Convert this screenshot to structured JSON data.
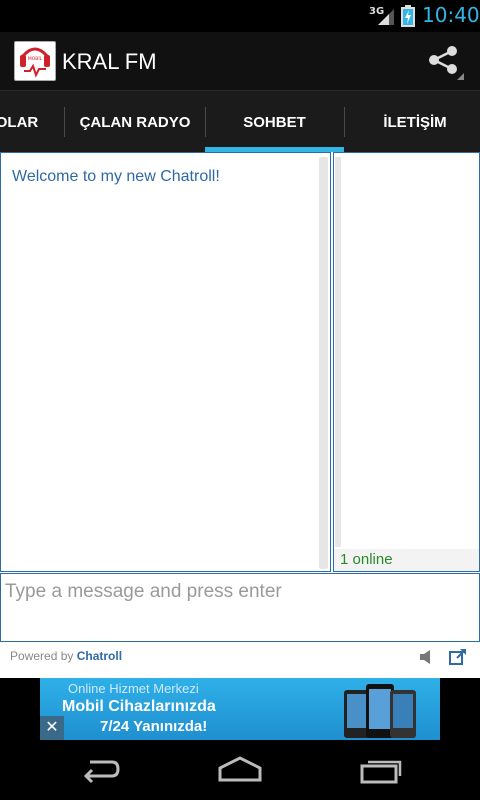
{
  "status_bar": {
    "network": "3G",
    "time": "10:40"
  },
  "action_bar": {
    "title": "KRAL FM",
    "logo_text": "Mobil Radyolar",
    "share_icon": "share-icon"
  },
  "tabs": [
    {
      "label": "OLAR",
      "selected": false
    },
    {
      "label": "ÇALAN RADYO",
      "selected": false
    },
    {
      "label": "SOHBET",
      "selected": true
    },
    {
      "label": "İLETİŞİM",
      "selected": false
    }
  ],
  "chat": {
    "welcome": "Welcome to my new Chatroll!",
    "online": "1 online",
    "input_placeholder": "Type a message and press enter",
    "powered_prefix": "Powered by ",
    "powered_brand": "Chatroll"
  },
  "ad": {
    "title": "Online Hizmet Merkezi",
    "line1": "Mobil Cihazlarınızda",
    "line2": "7/24 Yanınızda!",
    "close": "✕"
  },
  "colors": {
    "accent": "#33b5e5",
    "chat_blue": "#2f6aa5",
    "online_green": "#2a8a2a"
  }
}
